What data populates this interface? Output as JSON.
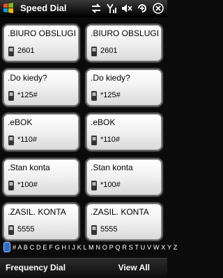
{
  "header": {
    "title": "Speed Dial"
  },
  "status_icons": [
    "start-icon",
    "sync-icon",
    "signal-icon",
    "volume-icon",
    "close-icon"
  ],
  "tiles": [
    {
      "name": ".BIURO OBSLUGI",
      "number": "2601"
    },
    {
      "name": ".BIURO OBSLUGI",
      "number": "2601"
    },
    {
      "name": ".Do kiedy?",
      "number": "*125#"
    },
    {
      "name": ".Do kiedy?",
      "number": "*125#"
    },
    {
      "name": ".eBOK",
      "number": "*110#"
    },
    {
      "name": ".eBOK",
      "number": "*110#"
    },
    {
      "name": ".Stan konta",
      "number": "*100#"
    },
    {
      "name": ".Stan konta",
      "number": "*100#"
    },
    {
      "name": ".ZASIL. KONTA",
      "number": "5555"
    },
    {
      "name": ".ZASIL. KONTA",
      "number": "5555"
    }
  ],
  "alphabet": "# A B C D E F G H I J K L M N O P Q R S T U V W X Y Z",
  "softkeys": {
    "left": "Frequency Dial",
    "right": "View All"
  }
}
